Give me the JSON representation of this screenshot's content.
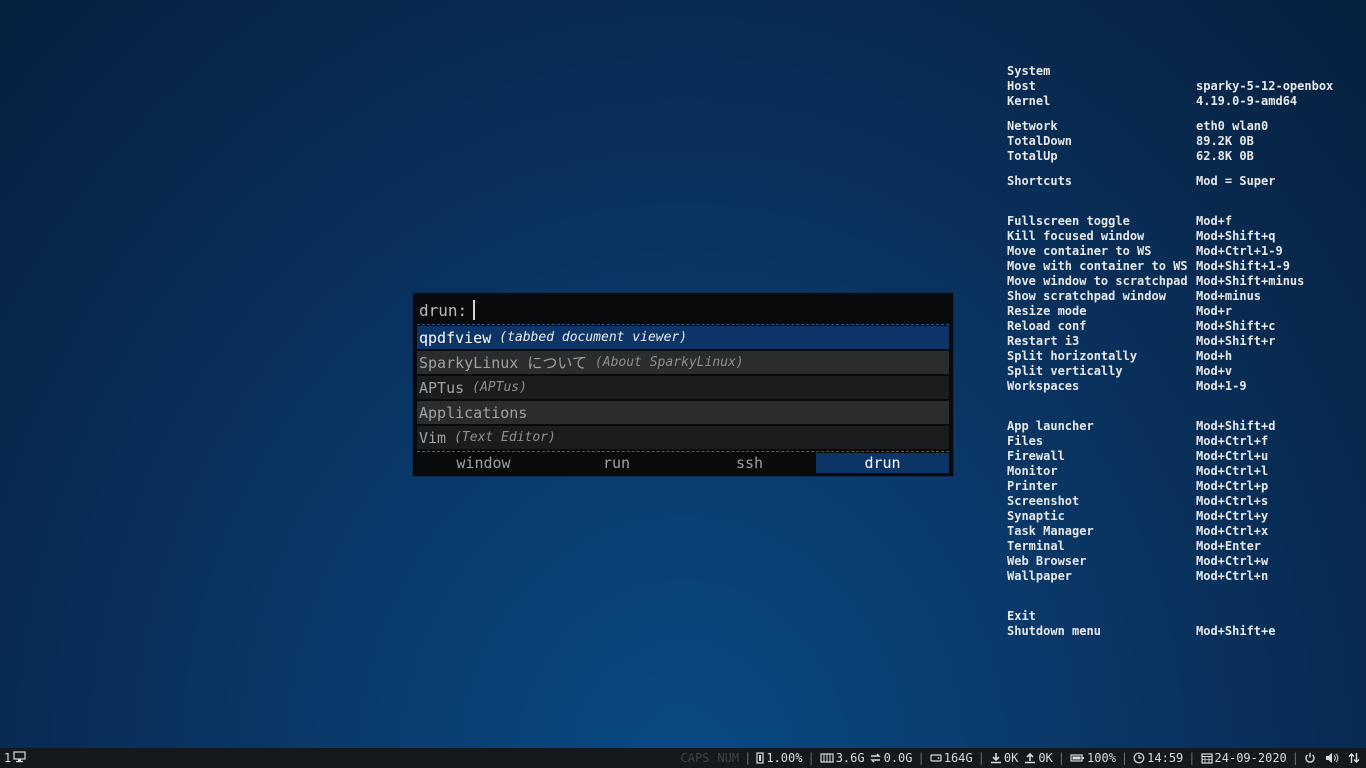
{
  "conky": {
    "rows": [
      {
        "k": "System",
        "v": ""
      },
      {
        "k": "Host",
        "v": "sparky-5-12-openbox"
      },
      {
        "k": "Kernel",
        "v": "4.19.0-9-amd64"
      },
      {
        "gap": 1
      },
      {
        "k": "Network",
        "v": "eth0   wlan0"
      },
      {
        "k": "TotalDown",
        "v": "89.2K  0B"
      },
      {
        "k": "TotalUp",
        "v": "62.8K  0B"
      },
      {
        "gap": 1
      },
      {
        "k": "Shortcuts",
        "v": "Mod = Super"
      },
      {
        "gap": 2
      },
      {
        "k": "Fullscreen toggle",
        "v": "Mod+f"
      },
      {
        "k": "Kill focused window",
        "v": "Mod+Shift+q"
      },
      {
        "k": "Move container to WS",
        "v": "Mod+Ctrl+1-9"
      },
      {
        "k": "Move with container to WS",
        "v": "Mod+Shift+1-9"
      },
      {
        "k": "Move window to scratchpad",
        "v": "Mod+Shift+minus"
      },
      {
        "k": "Show scratchpad window",
        "v": "Mod+minus"
      },
      {
        "k": "Resize mode",
        "v": "Mod+r"
      },
      {
        "k": "Reload conf",
        "v": "Mod+Shift+c"
      },
      {
        "k": "Restart i3",
        "v": "Mod+Shift+r"
      },
      {
        "k": "Split horizontally",
        "v": "Mod+h"
      },
      {
        "k": "Split vertically",
        "v": "Mod+v"
      },
      {
        "k": "Workspaces",
        "v": "Mod+1-9"
      },
      {
        "gap": 2
      },
      {
        "k": "App launcher",
        "v": "Mod+Shift+d"
      },
      {
        "k": "Files",
        "v": "Mod+Ctrl+f"
      },
      {
        "k": "Firewall",
        "v": "Mod+Ctrl+u"
      },
      {
        "k": "Monitor",
        "v": "Mod+Ctrl+l"
      },
      {
        "k": "Printer",
        "v": "Mod+Ctrl+p"
      },
      {
        "k": "Screenshot",
        "v": "Mod+Ctrl+s"
      },
      {
        "k": "Synaptic",
        "v": "Mod+Ctrl+y"
      },
      {
        "k": "Task Manager",
        "v": "Mod+Ctrl+x"
      },
      {
        "k": "Terminal",
        "v": "Mod+Enter"
      },
      {
        "k": "Web Browser",
        "v": "Mod+Ctrl+w"
      },
      {
        "k": "Wallpaper",
        "v": "Mod+Ctrl+n"
      },
      {
        "gap": 3
      },
      {
        "k": "Exit",
        "v": ""
      },
      {
        "k": "Shutdown menu",
        "v": "Mod+Shift+e"
      }
    ]
  },
  "rofi": {
    "prompt": "drun:",
    "entries": [
      {
        "name": "qpdfview",
        "desc": "(tabbed document viewer)",
        "state": "sel"
      },
      {
        "name": "SparkyLinux について",
        "desc": "(About SparkyLinux)",
        "state": "alt"
      },
      {
        "name": "APTus",
        "desc": "(APTus)",
        "state": "normal"
      },
      {
        "name": "Applications",
        "desc": "",
        "state": "alt"
      },
      {
        "name": "Vim",
        "desc": "(Text Editor)",
        "state": "normal"
      }
    ],
    "modes": [
      {
        "label": "window",
        "active": false
      },
      {
        "label": "run",
        "active": false
      },
      {
        "label": "ssh",
        "active": false
      },
      {
        "label": "drun",
        "active": true
      }
    ]
  },
  "bar": {
    "workspace": "1",
    "caps": "CAPS",
    "num": "NUM",
    "cpu": "1.00%",
    "mem": "3.6G",
    "swap": "0.0G",
    "disk": "164G",
    "down": "0K",
    "up": "0K",
    "battery": "100%",
    "time": "14:59",
    "date": "24-09-2020"
  }
}
